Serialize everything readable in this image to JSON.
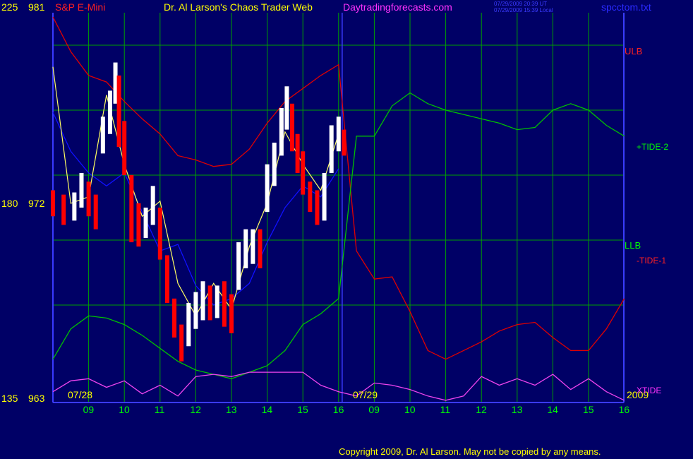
{
  "header": {
    "y_top_left": "225",
    "price_top": "981",
    "symbol": "S&P E-Mini",
    "title": "Dr. Al Larson's Chaos Trader Web",
    "site": "Daytradingforecasts.com",
    "timestamp_ut": "07/29/2009 20:39 UT",
    "timestamp_local": "07/29/2009 15:39 Local",
    "filename": "spcctom.txt"
  },
  "y_axis": {
    "left_ticks": [
      "225",
      "180",
      "135"
    ],
    "price_ticks": [
      "981",
      "972",
      "963"
    ]
  },
  "x_axis": {
    "dates": [
      "07/28",
      "07/29"
    ],
    "year": "2009",
    "day1_hours": [
      "09",
      "10",
      "11",
      "12",
      "13",
      "14",
      "15",
      "16"
    ],
    "day2_hours": [
      "09",
      "10",
      "11",
      "12",
      "13",
      "14",
      "15",
      "16"
    ]
  },
  "right_labels": {
    "ulb": "ULB",
    "tide_plus2": "+TIDE-2",
    "llb": "LLB",
    "tide_minus1": "-TIDE-1",
    "xtide": "XTIDE"
  },
  "footer": {
    "copyright": "Copyright 2009, Dr. Al Larson. May not be copied by any means."
  },
  "colors": {
    "background": "#000066",
    "grid": "#00a000",
    "axis": "#3a3aff",
    "up_bar": "#ffffff",
    "down_bar": "#ff0000",
    "ulb": "#e00000",
    "llb": "#00c000",
    "blue_line": "#1010ff",
    "yellow_line": "#ffff60",
    "xtide": "#ee44ee",
    "yellow_text": "#ffff00",
    "green_text": "#00ff00",
    "red_text": "#ff2020",
    "magenta_text": "#ff33ff",
    "blue_text": "#2a2aff"
  },
  "chart_data": {
    "type": "line",
    "x_unit": "trading hour",
    "price_range": [
      963,
      981
    ],
    "price_bars": [
      {
        "x": 0.0,
        "high": 972.8,
        "low": 971.6
      },
      {
        "x": 0.3,
        "high": 972.6,
        "low": 971.2
      },
      {
        "x": 0.6,
        "high": 972.7,
        "low": 971.4
      },
      {
        "x": 0.8,
        "high": 973.6,
        "low": 972.0
      },
      {
        "x": 1.0,
        "high": 973.2,
        "low": 971.6
      },
      {
        "x": 1.2,
        "high": 972.6,
        "low": 971.0
      },
      {
        "x": 1.4,
        "high": 976.2,
        "low": 974.5
      },
      {
        "x": 1.6,
        "high": 977.4,
        "low": 975.4
      },
      {
        "x": 1.75,
        "high": 978.7,
        "low": 976.8
      },
      {
        "x": 1.85,
        "high": 978.1,
        "low": 974.8
      },
      {
        "x": 2.0,
        "high": 976.0,
        "low": 973.5
      },
      {
        "x": 2.2,
        "high": 973.5,
        "low": 970.4
      },
      {
        "x": 2.4,
        "high": 972.2,
        "low": 970.2
      },
      {
        "x": 2.6,
        "high": 972.0,
        "low": 970.6
      },
      {
        "x": 2.8,
        "high": 973.0,
        "low": 971.2
      },
      {
        "x": 3.0,
        "high": 972.0,
        "low": 969.6
      },
      {
        "x": 3.2,
        "high": 969.8,
        "low": 967.6
      },
      {
        "x": 3.4,
        "high": 967.8,
        "low": 966.0
      },
      {
        "x": 3.6,
        "high": 966.6,
        "low": 964.9
      },
      {
        "x": 3.8,
        "high": 967.6,
        "low": 965.6
      },
      {
        "x": 4.0,
        "high": 968.1,
        "low": 966.4
      },
      {
        "x": 4.2,
        "high": 968.6,
        "low": 966.8
      },
      {
        "x": 4.4,
        "high": 968.4,
        "low": 966.8
      },
      {
        "x": 4.6,
        "high": 968.4,
        "low": 966.9
      },
      {
        "x": 4.8,
        "high": 968.6,
        "low": 966.5
      },
      {
        "x": 5.0,
        "high": 968.0,
        "low": 966.2
      },
      {
        "x": 5.2,
        "high": 970.4,
        "low": 968.2
      },
      {
        "x": 5.4,
        "high": 971.0,
        "low": 969.2
      },
      {
        "x": 5.6,
        "high": 971.0,
        "low": 969.4
      },
      {
        "x": 5.8,
        "high": 971.0,
        "low": 969.2
      },
      {
        "x": 6.0,
        "high": 974.0,
        "low": 971.8
      },
      {
        "x": 6.2,
        "high": 975.0,
        "low": 973.0
      },
      {
        "x": 6.4,
        "high": 976.6,
        "low": 974.4
      },
      {
        "x": 6.55,
        "high": 977.6,
        "low": 975.6
      },
      {
        "x": 6.7,
        "high": 976.8,
        "low": 974.6
      },
      {
        "x": 6.85,
        "high": 975.4,
        "low": 973.6
      },
      {
        "x": 7.0,
        "high": 974.6,
        "low": 972.6
      },
      {
        "x": 7.2,
        "high": 973.2,
        "low": 971.8
      },
      {
        "x": 7.4,
        "high": 972.8,
        "low": 971.2
      },
      {
        "x": 7.6,
        "high": 973.6,
        "low": 971.4
      },
      {
        "x": 7.8,
        "high": 975.8,
        "low": 973.6
      },
      {
        "x": 8.0,
        "high": 976.2,
        "low": 974.6
      },
      {
        "x": 8.15,
        "high": 975.6,
        "low": 974.4
      }
    ],
    "series": [
      {
        "name": "ULB",
        "x": [
          0,
          0.5,
          1,
          1.5,
          2,
          2.5,
          3,
          3.5,
          4,
          4.5,
          5,
          5.5,
          6,
          6.5,
          7,
          7.5,
          8,
          8.5,
          9,
          9.5,
          10,
          10.5,
          11,
          11.5,
          12,
          12.5,
          13,
          13.5,
          14,
          14.5,
          15,
          15.5,
          16
        ],
        "values": [
          980.8,
          979.2,
          978.1,
          977.8,
          976.9,
          976.1,
          975.4,
          974.4,
          974.2,
          973.9,
          974.0,
          974.7,
          975.9,
          976.9,
          977.5,
          978.1,
          978.6,
          970.0,
          968.7,
          968.8,
          967.2,
          965.4,
          965.0,
          965.4,
          965.8,
          966.3,
          966.6,
          966.7,
          966.0,
          965.4,
          965.4,
          966.4,
          967.8
        ]
      },
      {
        "name": "LLB",
        "x": [
          0,
          0.5,
          1,
          1.5,
          2,
          2.5,
          3,
          3.5,
          4,
          4.5,
          5,
          5.5,
          6,
          6.5,
          7,
          7.5,
          8,
          8.5,
          9,
          9.5,
          10,
          10.5,
          11,
          11.5,
          12,
          12.5,
          13,
          13.5,
          14,
          14.5,
          15,
          15.5,
          16
        ],
        "values": [
          965.0,
          966.4,
          967.0,
          966.9,
          966.6,
          966.1,
          965.5,
          964.9,
          964.5,
          964.3,
          964.1,
          964.4,
          964.7,
          965.4,
          966.6,
          967.1,
          967.8,
          975.3,
          975.3,
          976.7,
          977.3,
          976.8,
          976.5,
          976.3,
          976.1,
          975.9,
          975.6,
          975.7,
          976.5,
          976.8,
          976.5,
          975.8,
          975.3
        ]
      },
      {
        "name": "+TIDE-2",
        "x": [
          0,
          0.5,
          1,
          1.5,
          2,
          2.5,
          3,
          3.5,
          4,
          4.5,
          5,
          5.5,
          6,
          6.5,
          7,
          7.5,
          8
        ],
        "values": [
          976.4,
          974.6,
          973.6,
          973.0,
          973.6,
          971.8,
          970.0,
          970.3,
          968.4,
          967.5,
          967.8,
          968.5,
          970.4,
          972.0,
          973.0,
          972.5,
          973.8
        ]
      },
      {
        "name": "fast",
        "x": [
          0,
          0.5,
          1,
          1.5,
          2,
          2.5,
          3,
          3.5,
          4,
          4.5,
          5,
          5.5,
          6,
          6.5,
          7,
          7.5,
          8
        ],
        "values": [
          978.5,
          972.2,
          972.5,
          977.2,
          974.0,
          971.6,
          972.3,
          968.5,
          967.0,
          968.5,
          967.3,
          970.2,
          972.2,
          975.5,
          974.0,
          972.8,
          975.4
        ]
      },
      {
        "name": "XTIDE",
        "x": [
          0,
          0.5,
          1,
          1.5,
          2,
          2.5,
          3,
          3.5,
          4,
          4.5,
          5,
          5.5,
          6,
          6.5,
          7,
          7.5,
          8,
          8.5,
          9,
          9.5,
          10,
          10.5,
          11,
          11.5,
          12,
          12.5,
          13,
          13.5,
          14,
          14.5,
          15,
          15.5,
          16
        ],
        "values": [
          963.5,
          964.0,
          964.1,
          963.7,
          964.0,
          963.4,
          963.8,
          963.3,
          964.2,
          964.3,
          964.2,
          964.4,
          964.4,
          964.4,
          964.4,
          963.8,
          963.5,
          963.3,
          963.9,
          963.8,
          963.6,
          963.3,
          963.1,
          963.3,
          964.2,
          963.8,
          964.1,
          963.8,
          964.3,
          963.6,
          964.1,
          963.5,
          963.1
        ]
      }
    ]
  }
}
